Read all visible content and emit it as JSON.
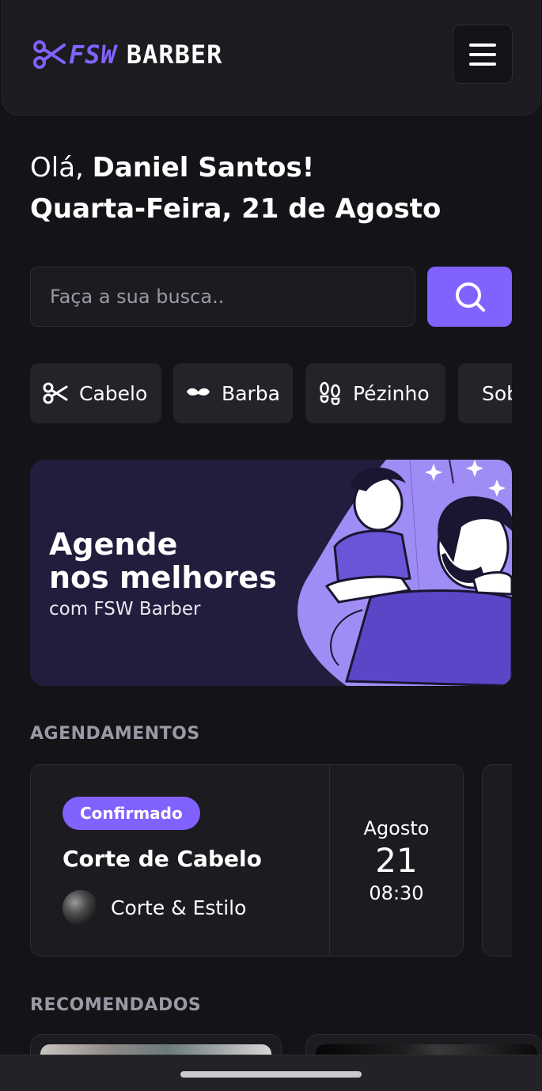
{
  "header": {
    "logo_prefix": "FSW",
    "logo_name": "BARBER",
    "menu_icon": "hamburger-icon"
  },
  "greeting": {
    "hello": "Olá, ",
    "name": "Daniel Santos!",
    "date": "Quarta-Feira, 21 de Agosto"
  },
  "search": {
    "placeholder": "Faça a sua busca..",
    "button_icon": "search-icon"
  },
  "categories": [
    {
      "label": "Cabelo",
      "icon": "scissors-icon"
    },
    {
      "label": "Barba",
      "icon": "mustache-icon"
    },
    {
      "label": "Pézinho",
      "icon": "footprints-icon"
    },
    {
      "label": "Sobrancelha",
      "icon": "eyebrow-icon"
    }
  ],
  "banner": {
    "title_line1": "Agende",
    "title_line2": "nos melhores",
    "subtitle": "com FSW Barber"
  },
  "bookings": {
    "section_title": "AGENDAMENTOS",
    "items": [
      {
        "status": "Confirmado",
        "service": "Corte de Cabelo",
        "shop": "Corte & Estilo",
        "month": "Agosto",
        "day": "21",
        "time": "08:30"
      }
    ]
  },
  "recommended": {
    "section_title": "RECOMENDADOS"
  },
  "colors": {
    "background": "#141318",
    "card": "#1b1b20",
    "accent": "#8162ff",
    "muted_text": "#9a9aa6"
  }
}
